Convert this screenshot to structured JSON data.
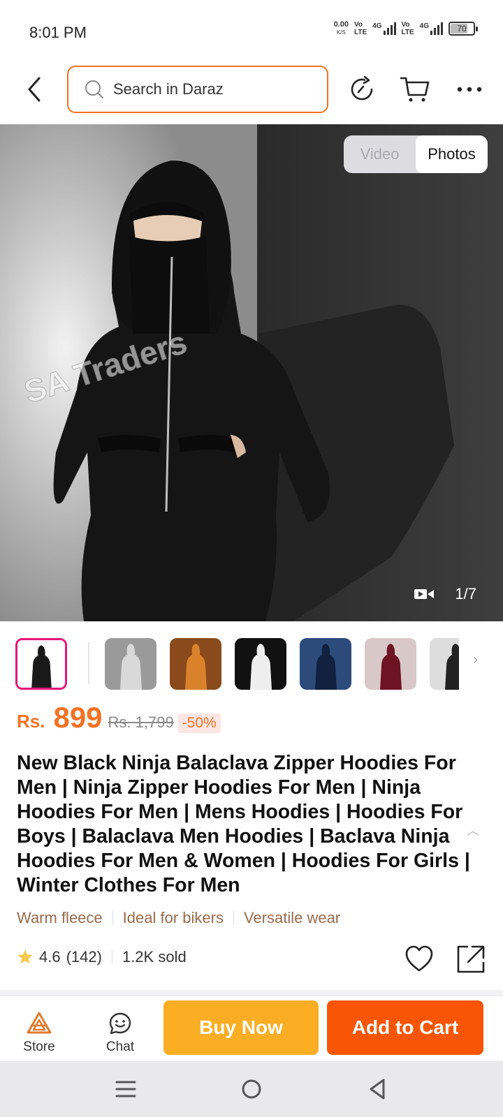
{
  "status_bar": {
    "time": "8:01 PM",
    "net_speed": "0.00",
    "net_unit": "K/S",
    "sim1_top": "Vo",
    "sim1_bottom": "LTE",
    "sim1_gen": "4G",
    "sim2_top": "Vo",
    "sim2_bottom": "LTE",
    "sim2_gen": "4G",
    "battery": "70"
  },
  "header": {
    "search_placeholder": "Search in Daraz"
  },
  "gallery": {
    "watermark": "SA Traders",
    "toggle_video": "Video",
    "toggle_photos": "Photos",
    "counter": "1/7",
    "thumbnails": [
      {
        "color": "#1a1a1a",
        "bg": "#ffffff"
      },
      {
        "color": "#d9d9d9",
        "bg": "#9a9a9a"
      },
      {
        "color": "#d9822b",
        "bg": "#8a4a1c"
      },
      {
        "color": "#eeeeee",
        "bg": "#111111"
      },
      {
        "color": "#12213f",
        "bg": "#2c4a7a"
      },
      {
        "color": "#6e1324",
        "bg": "#d9c8c8"
      },
      {
        "color": "#222222",
        "bg": "#dddddd"
      }
    ]
  },
  "product": {
    "currency": "Rs.",
    "price": "899",
    "original_price": "Rs. 1,799",
    "discount": "-50%",
    "title": "New Black Ninja Balaclava Zipper Hoodies For Men | Ninja Zipper Hoodies For Men | Ninja Hoodies For Men | Mens Hoodies | Hoodies For Boys | Balaclava Men Hoodies | Baclava Ninja Hoodies For Men & Women | Hoodies For Girls | Winter Clothes For Men",
    "features": [
      "Warm fleece",
      "Ideal for bikers",
      "Versatile wear"
    ],
    "rating": "4.6",
    "reviews": "(142)",
    "sold": "1.2K sold"
  },
  "action_bar": {
    "store_label": "Store",
    "chat_label": "Chat",
    "buy_now": "Buy Now",
    "add_to_cart": "Add to Cart"
  },
  "colors": {
    "accent": "#f57224",
    "buy_now": "#fbae24",
    "add_to_cart": "#f85606"
  }
}
